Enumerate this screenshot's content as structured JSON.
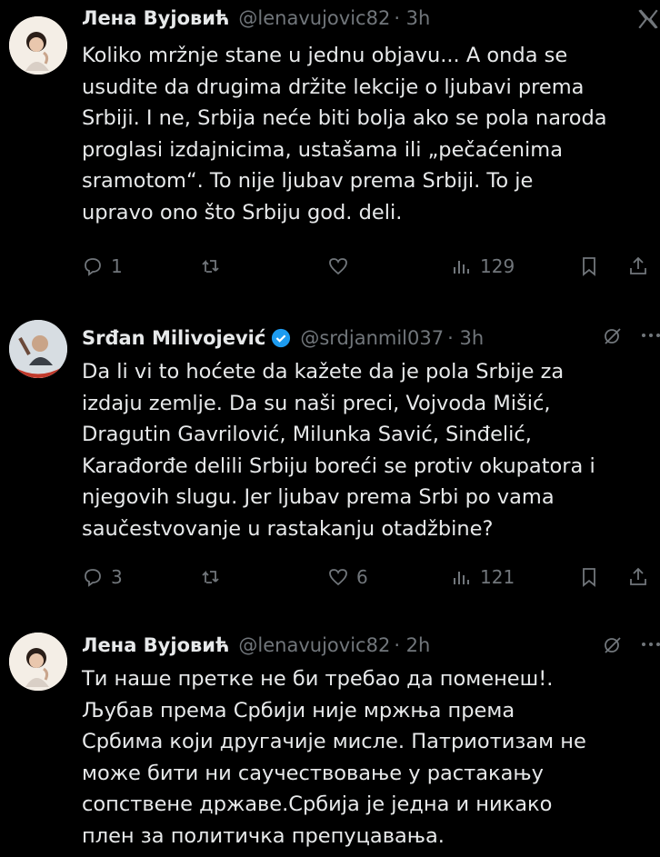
{
  "tweets": [
    {
      "author": "Лена Вујовић",
      "handle": "@lenavujovic82",
      "time": "· 3h",
      "text": "Koliko mržnje stane u jednu objavu... A onda se\nusudite da drugima držite lekcije o ljubavi prema\nSrbiji. I ne, Srbija neće biti bolja ako se pola naroda\nproglasi izdajnicima, ustašama ili „pečaćenima\nsramotom“. To nije ljubav prema Srbiji. To je\nupravo ono što Srbiju god. deli.",
      "replies": "1",
      "reposts": "",
      "likes": "",
      "views": "129"
    },
    {
      "author": "Srđan Milivojević",
      "handle": "@srdjanmil037",
      "time": "· 3h",
      "text": "Da li vi to hoćete da kažete da je pola Srbije za\nizdaju zemlje. Da su naši preci, Vojvoda Mišić,\nDragutin Gavrilović, Milunka Savić, Sinđelić,\nKarađorđe delili Srbiju boreći se protiv okupatora i\nnjegovih slugu. Jer ljubav prema Srbi po vama\nsaučestvovanje u rastakanju otadžbine?",
      "replies": "3",
      "reposts": "",
      "likes": "6",
      "views": "121"
    },
    {
      "author": "Лена Вујовић",
      "handle": "@lenavujovic82",
      "time": "· 2h",
      "text": "Ти наше претке не би требао да поменеш!.\nЉубав према Србији није мржња према\nСрбима који другачије мисле. Патриотизам не\nможе бити ни саучествовање у растакању\nсопствене државе.Србија је једна и никако\nплен за политичка препуцавања."
    }
  ],
  "icons": {
    "logo": "x-logo-icon",
    "reply": "reply-icon",
    "repost": "repost-icon",
    "like": "heart-icon",
    "views": "views-icon",
    "bookmark": "bookmark-icon",
    "share": "share-icon",
    "grok": "grok-icon",
    "more": "more-icon",
    "verified": "verified-badge-icon"
  },
  "colors": {
    "background": "#000000",
    "text": "#e7e9ea",
    "muted": "#71767b",
    "verified": "#1d9bf0"
  }
}
